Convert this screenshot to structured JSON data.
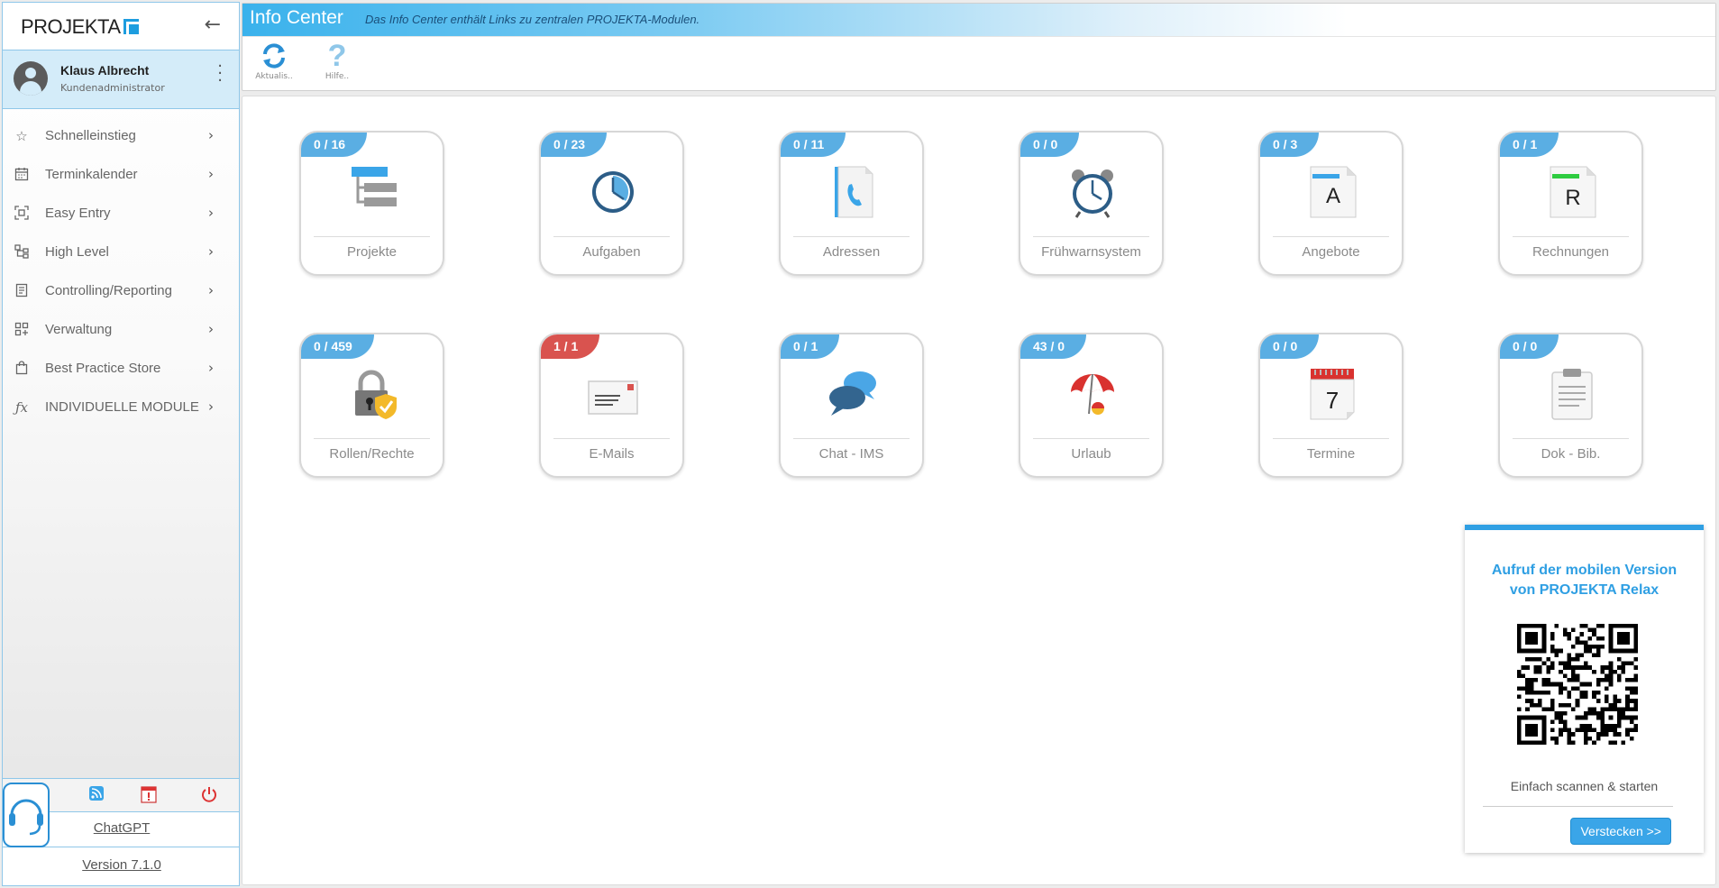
{
  "sidebar": {
    "logo_text": "PROJEKTA",
    "user": {
      "name": "Klaus Albrecht",
      "role": "Kundenadministrator"
    },
    "nav": [
      {
        "label": "Schnelleinstieg",
        "icon": "star-icon"
      },
      {
        "label": "Terminkalender",
        "icon": "calendar-icon"
      },
      {
        "label": "Easy Entry",
        "icon": "focus-icon"
      },
      {
        "label": "High Level",
        "icon": "hierarchy-icon"
      },
      {
        "label": "Controlling/Reporting",
        "icon": "report-icon"
      },
      {
        "label": "Verwaltung",
        "icon": "grid-add-icon"
      },
      {
        "label": "Best Practice Store",
        "icon": "shopping-bag-icon"
      },
      {
        "label": "INDIVIDUELLE MODULE",
        "icon": "function-icon"
      }
    ],
    "chatgpt_label": "ChatGPT",
    "version_label": "Version 7.1.0"
  },
  "header": {
    "title": "Info Center",
    "subtitle": "Das Info Center enthält Links zu zentralen PROJEKTA-Modulen.",
    "toolbar": [
      {
        "label": "Aktualis.."
      },
      {
        "label": "Hilfe.."
      }
    ]
  },
  "tiles": [
    {
      "label": "Projekte",
      "badge": "0 / 16",
      "badge_color": "blue",
      "icon": "project-tree-icon"
    },
    {
      "label": "Aufgaben",
      "badge": "0 / 23",
      "badge_color": "blue",
      "icon": "clock-icon"
    },
    {
      "label": "Adressen",
      "badge": "0 / 11",
      "badge_color": "blue",
      "icon": "address-book-icon"
    },
    {
      "label": "Frühwarnsystem",
      "badge": "0 / 0",
      "badge_color": "blue",
      "icon": "alarm-clock-icon"
    },
    {
      "label": "Angebote",
      "badge": "0 / 3",
      "badge_color": "blue",
      "icon": "offer-document-icon"
    },
    {
      "label": "Rechnungen",
      "badge": "0 / 1",
      "badge_color": "blue",
      "icon": "invoice-document-icon"
    },
    {
      "label": "Rollen/Rechte",
      "badge": "0 / 459",
      "badge_color": "blue",
      "icon": "lock-shield-icon"
    },
    {
      "label": "E-Mails",
      "badge": "1 / 1",
      "badge_color": "red",
      "icon": "envelope-icon"
    },
    {
      "label": "Chat - IMS",
      "badge": "0 / 1",
      "badge_color": "blue",
      "icon": "chat-bubbles-icon"
    },
    {
      "label": "Urlaub",
      "badge": "43 / 0",
      "badge_color": "blue",
      "icon": "beach-umbrella-icon"
    },
    {
      "label": "Termine",
      "badge": "0 / 0",
      "badge_color": "blue",
      "icon": "calendar-page-icon"
    },
    {
      "label": "Dok - Bib.",
      "badge": "0 / 0",
      "badge_color": "blue",
      "icon": "clipboard-icon"
    }
  ],
  "tile_icon_text": {
    "offer": "A",
    "invoice": "R",
    "calendar_day": "7"
  },
  "qr_panel": {
    "title_line1": "Aufruf der mobilen Version",
    "title_line2": "von PROJEKTA Relax",
    "caption": "Einfach scannen & starten",
    "hide_button": "Verstecken >>"
  },
  "colors": {
    "accent": "#2f9fe3",
    "badge_blue": "#5aaee3",
    "badge_red": "#d9534f",
    "sidebar_border": "#8fc7e9"
  }
}
